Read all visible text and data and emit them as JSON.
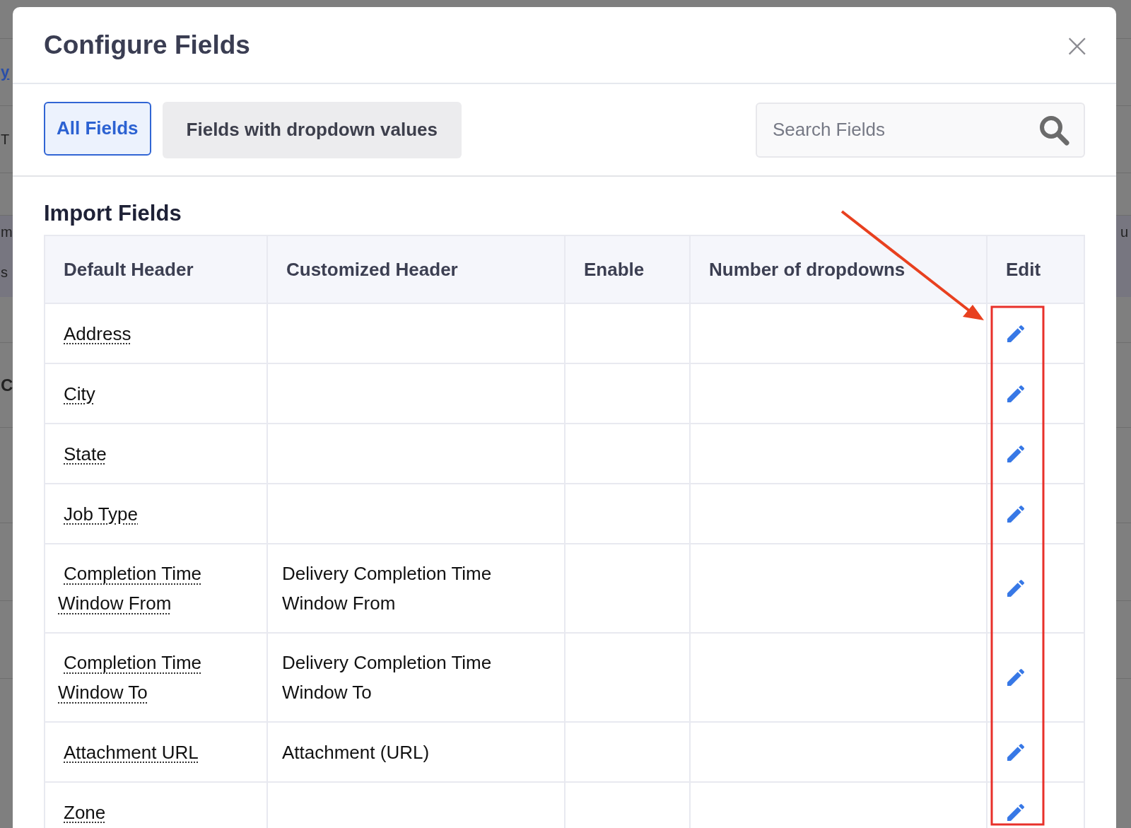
{
  "backdrop": {
    "left_edge": [
      "y",
      "T",
      "m",
      "s",
      "C"
    ],
    "right_edge": [
      "u"
    ]
  },
  "dialog": {
    "title": "Configure Fields",
    "close": "×"
  },
  "tabs": [
    {
      "label": "All Fields",
      "selected": true
    },
    {
      "label": "Fields with dropdown values",
      "selected": false
    }
  ],
  "search": {
    "placeholder": "Search Fields"
  },
  "section_title": "Import Fields",
  "table": {
    "columns": [
      "Default Header",
      "Customized Header",
      "Enable",
      "Number of dropdowns",
      "Edit"
    ],
    "rows": [
      {
        "default_header": "Address",
        "customized_header": ""
      },
      {
        "default_header": "City",
        "customized_header": ""
      },
      {
        "default_header": "State",
        "customized_header": ""
      },
      {
        "default_header": "Job Type",
        "customized_header": ""
      },
      {
        "default_header": "Completion Time Window From",
        "customized_header": "Delivery Completion Time Window From"
      },
      {
        "default_header": "Completion Time Window To",
        "customized_header": "Delivery Completion Time Window To"
      },
      {
        "default_header": "Attachment URL",
        "customized_header": "Attachment (URL)"
      },
      {
        "default_header": "Zone",
        "customized_header": ""
      }
    ]
  }
}
